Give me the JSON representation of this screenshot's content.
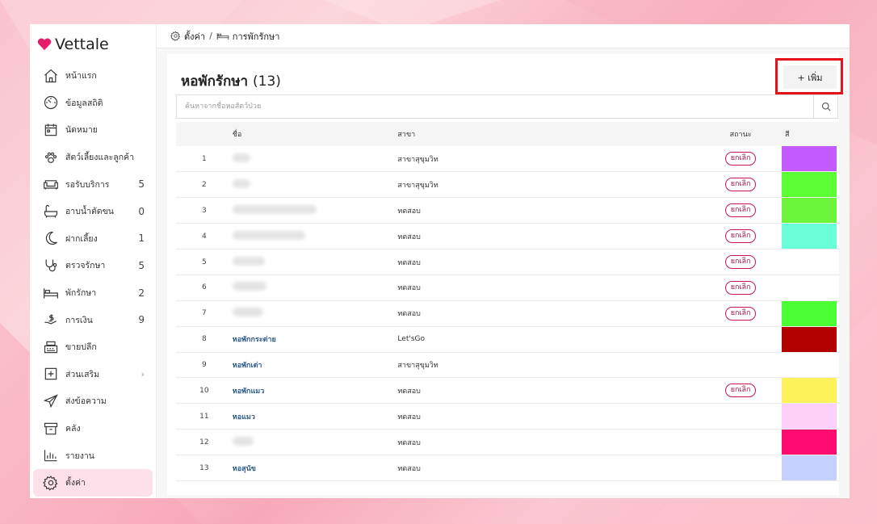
{
  "app": {
    "brand": "Vettale",
    "brand_color": "#e61c6a"
  },
  "sidebar": {
    "items": [
      {
        "key": "home",
        "label": "หน้าแรก",
        "icon": "home-icon",
        "count": ""
      },
      {
        "key": "stats",
        "label": "ข้อมูลสถิติ",
        "icon": "dashboard-gauge-icon",
        "count": ""
      },
      {
        "key": "appointments",
        "label": "นัดหมาย",
        "icon": "calendar-icon",
        "count": ""
      },
      {
        "key": "pets",
        "label": "สัตว์เลี้ยงและลูกค้า",
        "icon": "paw-icon",
        "count": ""
      },
      {
        "key": "waiting",
        "label": "รอรับบริการ",
        "icon": "sofa-icon",
        "count": "5"
      },
      {
        "key": "grooming",
        "label": "อาบน้ำตัดขน",
        "icon": "bathtub-icon",
        "count": "0"
      },
      {
        "key": "boarding",
        "label": "ฝากเลี้ยง",
        "icon": "moon-icon",
        "count": "1"
      },
      {
        "key": "exam",
        "label": "ตรวจรักษา",
        "icon": "stethoscope-icon",
        "count": "5"
      },
      {
        "key": "admit",
        "label": "พักรักษา",
        "icon": "bed-icon",
        "count": "2"
      },
      {
        "key": "finance",
        "label": "การเงิน",
        "icon": "money-hand-icon",
        "count": "9"
      },
      {
        "key": "retail",
        "label": "ขายปลีก",
        "icon": "cash-register-icon",
        "count": ""
      },
      {
        "key": "addons",
        "label": "ส่วนเสริม",
        "icon": "plus-square-icon",
        "count": ""
      },
      {
        "key": "messages",
        "label": "ส่งข้อความ",
        "icon": "send-icon",
        "count": ""
      },
      {
        "key": "inventory",
        "label": "คลัง",
        "icon": "archive-box-icon",
        "count": ""
      },
      {
        "key": "reports",
        "label": "รายงาน",
        "icon": "bar-chart-icon",
        "count": ""
      },
      {
        "key": "settings",
        "label": "ตั้งค่า",
        "icon": "gear-icon",
        "count": ""
      }
    ],
    "active_key": "settings"
  },
  "breadcrumb": {
    "settings": "ตั้งค่า",
    "separator": "/",
    "current": "การพักรักษา"
  },
  "page": {
    "title": "หอพักรักษา",
    "count": "(13)",
    "add_label": "+ เพิ่ม",
    "search_placeholder": "ค้นหาจากชื่อหอสัตว์ป่วย"
  },
  "table": {
    "headers": {
      "name": "ชื่อ",
      "branch": "สาขา",
      "status": "สถานะ",
      "color": "สี"
    },
    "status_label": "ยกเลิก",
    "rows": [
      {
        "num": "1",
        "name": "",
        "branch": "สาขาสุขุมวิท",
        "cancelled": true,
        "color": "#c35bff"
      },
      {
        "num": "2",
        "name": "",
        "branch": "สาขาสุขุมวิท",
        "cancelled": true,
        "color": "#5cff36"
      },
      {
        "num": "3",
        "name": "",
        "branch": "ทดสอบ",
        "cancelled": true,
        "color": "#6cf53a"
      },
      {
        "num": "4",
        "name": "",
        "branch": "ทดสอบ",
        "cancelled": true,
        "color": "#68ffd8"
      },
      {
        "num": "5",
        "name": "",
        "branch": "ทดสอบ",
        "cancelled": true,
        "color": ""
      },
      {
        "num": "6",
        "name": "",
        "branch": "ทดสอบ",
        "cancelled": true,
        "color": ""
      },
      {
        "num": "7",
        "name": "",
        "branch": "ทดสอบ",
        "cancelled": true,
        "color": "#4cff33"
      },
      {
        "num": "8",
        "name": "หอพักกระต่าย",
        "branch": "Let'sGo",
        "cancelled": false,
        "color": "#b30000"
      },
      {
        "num": "9",
        "name": "หอพักเต่า",
        "branch": "สาขาสุขุมวิท",
        "cancelled": false,
        "color": ""
      },
      {
        "num": "10",
        "name": "หอพักแมว",
        "branch": "ทดสอบ",
        "cancelled": true,
        "color": "#fff35c"
      },
      {
        "num": "11",
        "name": "หอแมว",
        "branch": "ทดสอบ",
        "cancelled": false,
        "color": "#fcd0f8"
      },
      {
        "num": "12",
        "name": "",
        "branch": "ทดสอบ",
        "cancelled": false,
        "color": "#ff0a6e"
      },
      {
        "num": "13",
        "name": "หอสุนัข",
        "branch": "ทดสอบ",
        "cancelled": false,
        "color": "#c5d0ff"
      }
    ]
  }
}
